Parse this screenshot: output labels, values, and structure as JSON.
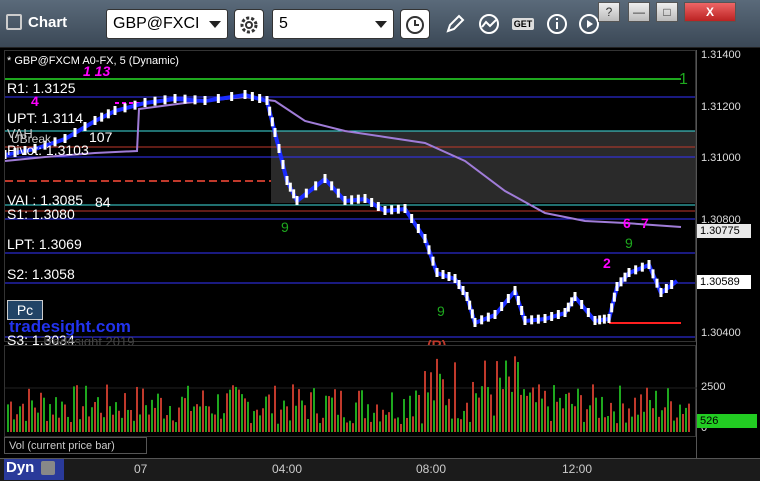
{
  "app": {
    "title": "Chart"
  },
  "toolbar": {
    "symbol": "GBP@FXCI",
    "interval": "5",
    "get_label": "GET"
  },
  "window_buttons": {
    "help": "?",
    "minimize": "—",
    "maximize": "□",
    "close": "X"
  },
  "chart": {
    "legend": "* GBP@FXCM A0-FX, 5 (Dynamic)",
    "watermark_site": "tradesight.com",
    "watermark_copy": "Tradesight 2019",
    "pc_label": "Pc",
    "levels": [
      {
        "label": "R1: 1.3125"
      },
      {
        "label": "UPT: 1.3114"
      },
      {
        "label": "Pivot: 1.3103"
      },
      {
        "label": "VAI : 1.3085"
      },
      {
        "label": "S1: 1.3080"
      },
      {
        "label": "LPT: 1.3069"
      },
      {
        "label": "S2: 1.3058"
      },
      {
        "label": "S3: 1.3034"
      }
    ],
    "partial_labels": [
      "VAH",
      "107",
      "84",
      "UBreak"
    ],
    "counts": {
      "magenta_1_13": "1 13",
      "magenta_4": "4",
      "green_9a": "9",
      "green_9b": "9",
      "magenta_2": "2",
      "magenta_6": "6",
      "magenta_7": "7",
      "green_1": "1",
      "green_9c": "9",
      "red_R": "(R)"
    },
    "price_axis": [
      "1.31400",
      "1.31200",
      "1.31000",
      "1.30800",
      "1.30600",
      "1.30400"
    ],
    "price_tags": [
      {
        "value": "1.30775",
        "bg": "#e8e8e8",
        "fg": "#000"
      },
      {
        "value": "1.30589",
        "bg": "#ffffff",
        "fg": "#000"
      }
    ]
  },
  "volume": {
    "label": "Vol (current price bar)",
    "axis": [
      "2500",
      "0"
    ],
    "current_tag": "526",
    "tag_color": "#22cc22"
  },
  "time_axis": {
    "dyn_label": "Dyn",
    "labels": [
      "07",
      "04:00",
      "08:00",
      "12:00"
    ]
  },
  "colors": {
    "accent_blue": "#1a2cff",
    "magenta": "#ff00ff",
    "green_line": "#1ea81e",
    "red_line": "#c0392b",
    "cyan_line": "#40e0e0",
    "purple_ma": "#a07cd8"
  }
}
